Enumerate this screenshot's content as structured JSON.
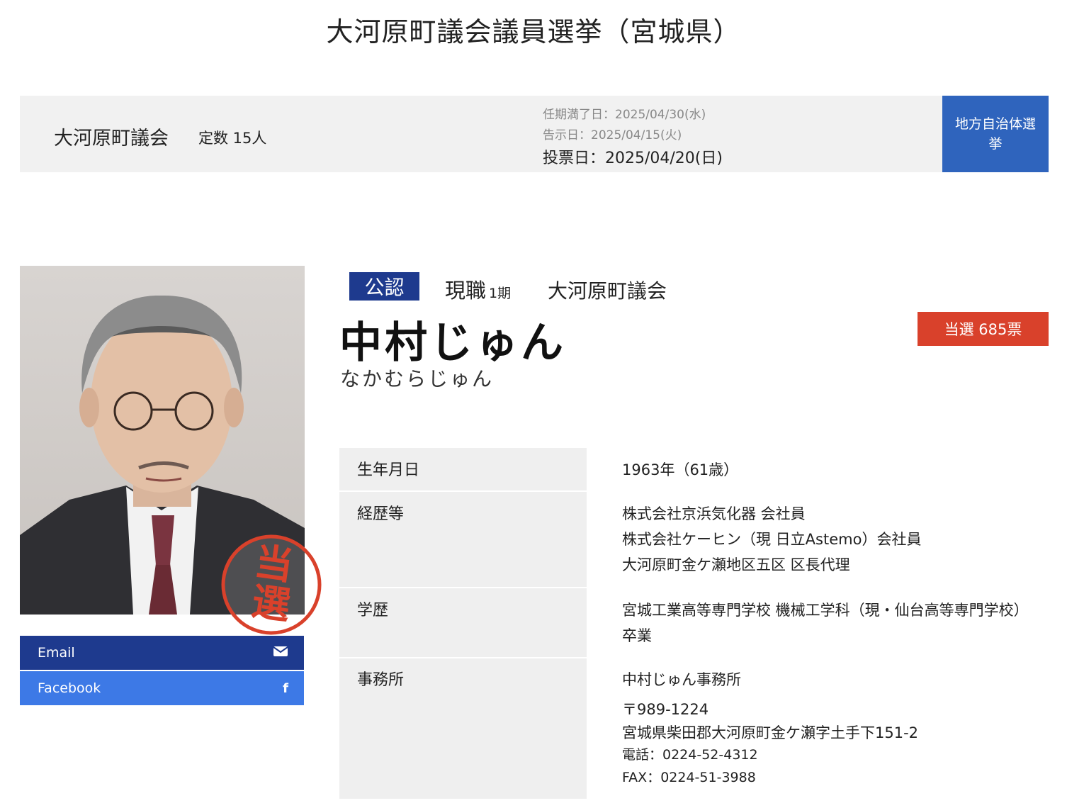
{
  "page_title": "大河原町議会議員選挙（宮城県）",
  "election": {
    "assembly_name": "大河原町議会",
    "seat_count": "定数 15人",
    "term_end": "任期満了日：2025/04/30(水)",
    "notice_date": "告示日：2025/04/15(火)",
    "vote_date": "投票日：2025/04/20(日)",
    "category_badge": "地方自治体選挙"
  },
  "candidate": {
    "official_badge": "公認",
    "status": "現職",
    "terms": "1期",
    "constituency": "大河原町議会",
    "name": "中村じゅん",
    "kana": "なかむらじゅん",
    "result": "当選 685票",
    "stamp_text": "当選"
  },
  "sns": {
    "email_label": "Email",
    "facebook_label": "Facebook",
    "email_icon": "envelope-icon",
    "facebook_icon": "facebook-f-icon"
  },
  "profile": {
    "birth_label": "生年月日",
    "birth_value": "1963年（61歳）",
    "career_label": "経歴等",
    "career_lines": [
      "株式会社京浜気化器 会社員",
      "株式会社ケーヒン（現 日立Astemo）会社員",
      "大河原町金ケ瀬地区五区 区長代理"
    ],
    "education_label": "学歴",
    "education_value": "宮城工業高等専門学校 機械工学科（現・仙台高等専門学校）卒業",
    "office_label": "事務所",
    "office_name": "中村じゅん事務所",
    "office_postal": "〒989-1224",
    "office_address": "宮城県柴田郡大河原町金ケ瀬字土手下151-2",
    "office_phone": "電話：0224-52-4312",
    "office_fax": "FAX：0224-51-3988"
  },
  "colors": {
    "navy": "#1e3a8e",
    "blue": "#2f64bd",
    "facebook_blue": "#3d79e6",
    "red": "#d9412b",
    "table_label_bg": "#efefef",
    "bar_bg": "#f1f1f1"
  }
}
